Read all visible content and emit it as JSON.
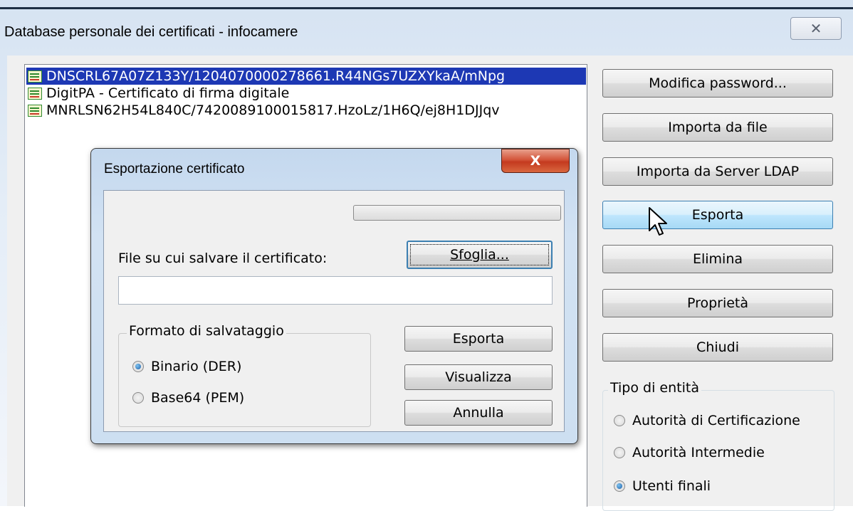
{
  "window": {
    "title": "Database personale dei certificati - infocamere",
    "close_glyph": "✕"
  },
  "certificates": [
    {
      "label": "DNSCRL67A07Z133Y/1204070000278661.R44NGs7UZXYkaA/mNpg",
      "selected": true,
      "icon": "certificate-icon"
    },
    {
      "label": "DigitPA - Certificato di firma digitale",
      "selected": false,
      "icon": "certificate-icon"
    },
    {
      "label": "MNRLSN62H54L840C/7420089100015817.HzoLz/1H6Q/ej8H1DJJqv",
      "selected": false,
      "icon": "certificate-icon"
    }
  ],
  "actions": {
    "modify_password": "Modifica password...",
    "import_file": "Importa da file",
    "import_ldap": "Importa da Server LDAP",
    "export": "Esporta",
    "delete": "Elimina",
    "properties": "Proprietà",
    "close": "Chiudi"
  },
  "entity_type": {
    "title": "Tipo di entità",
    "options": [
      {
        "label": "Autorità di Certificazione",
        "checked": false
      },
      {
        "label": "Autorità Intermedie",
        "checked": false
      },
      {
        "label": "Utenti finali",
        "checked": true
      }
    ]
  },
  "export_dialog": {
    "title": "Esportazione certificato",
    "close_glyph": "X",
    "progress": 0,
    "file_label": "File su cui salvare il certificato:",
    "browse": "Sfoglia...",
    "file_value": "",
    "format": {
      "title": "Formato di salvataggio",
      "options": [
        {
          "label": "Binario (DER)",
          "checked": true
        },
        {
          "label": "Base64 (PEM)",
          "checked": false
        }
      ]
    },
    "export": "Esporta",
    "view": "Visualizza",
    "cancel": "Annulla"
  },
  "colors": {
    "selection": "#1d38b4",
    "dialog_frame": "#c4d8ee",
    "close_red": "#c43a1f"
  }
}
